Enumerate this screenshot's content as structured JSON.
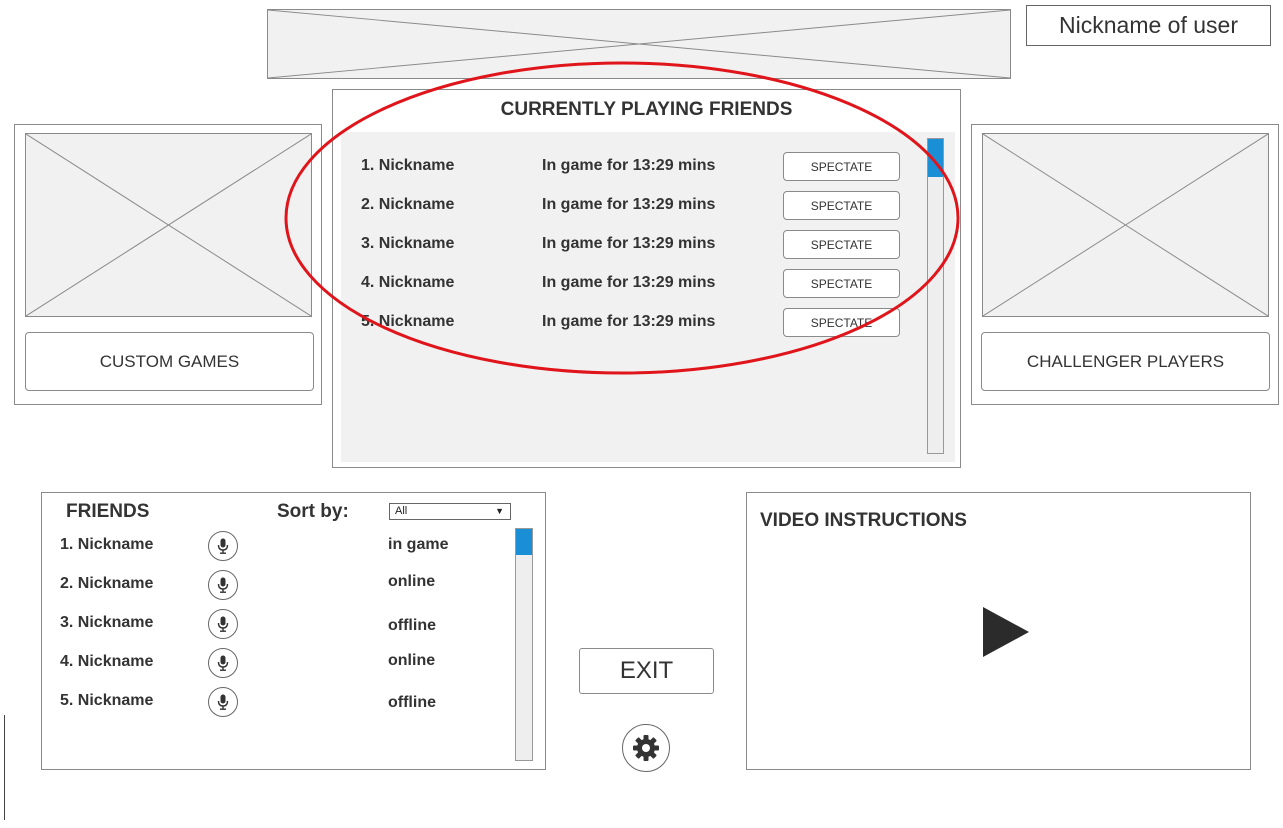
{
  "header": {
    "user_nickname": "Nickname of user"
  },
  "playing": {
    "title": "CURRENTLY PLAYING FRIENDS",
    "rows": [
      {
        "name": "1. Nickname",
        "status": "In game for 13:29 mins",
        "button": "SPECTATE"
      },
      {
        "name": "2. Nickname",
        "status": "In game for 13:29 mins",
        "button": "SPECTATE"
      },
      {
        "name": "3. Nickname",
        "status": "In game for 13:29 mins",
        "button": "SPECTATE"
      },
      {
        "name": "4. Nickname",
        "status": "In game for 13:29 mins",
        "button": "SPECTATE"
      },
      {
        "name": "5. Nickname",
        "status": "In game for 13:29 mins",
        "button": "SPECTATE"
      }
    ]
  },
  "left_card": {
    "button": "CUSTOM GAMES"
  },
  "right_card": {
    "button": "CHALLENGER PLAYERS"
  },
  "friends": {
    "title": "FRIENDS",
    "sort_label": "Sort by:",
    "sort_value": "All",
    "rows": [
      {
        "name": "1. Nickname",
        "status": "in game"
      },
      {
        "name": "2. Nickname",
        "status": "online"
      },
      {
        "name": "3. Nickname",
        "status": "offline"
      },
      {
        "name": "4. Nickname",
        "status": "online"
      },
      {
        "name": "5. Nickname",
        "status": "offline"
      }
    ]
  },
  "exit_button": "EXIT",
  "video": {
    "title": "VIDEO INSTRUCTIONS"
  },
  "icons": {
    "mic": "microphone-icon",
    "settings": "gear-icon",
    "play": "play-icon",
    "dropdown": "triangle-down-icon",
    "placeholder": "image-placeholder"
  },
  "colors": {
    "accent": "#1a8fd6",
    "annotation": "#e0151b",
    "panel_bg": "#f1f1f1",
    "border": "#8a8a8a"
  }
}
